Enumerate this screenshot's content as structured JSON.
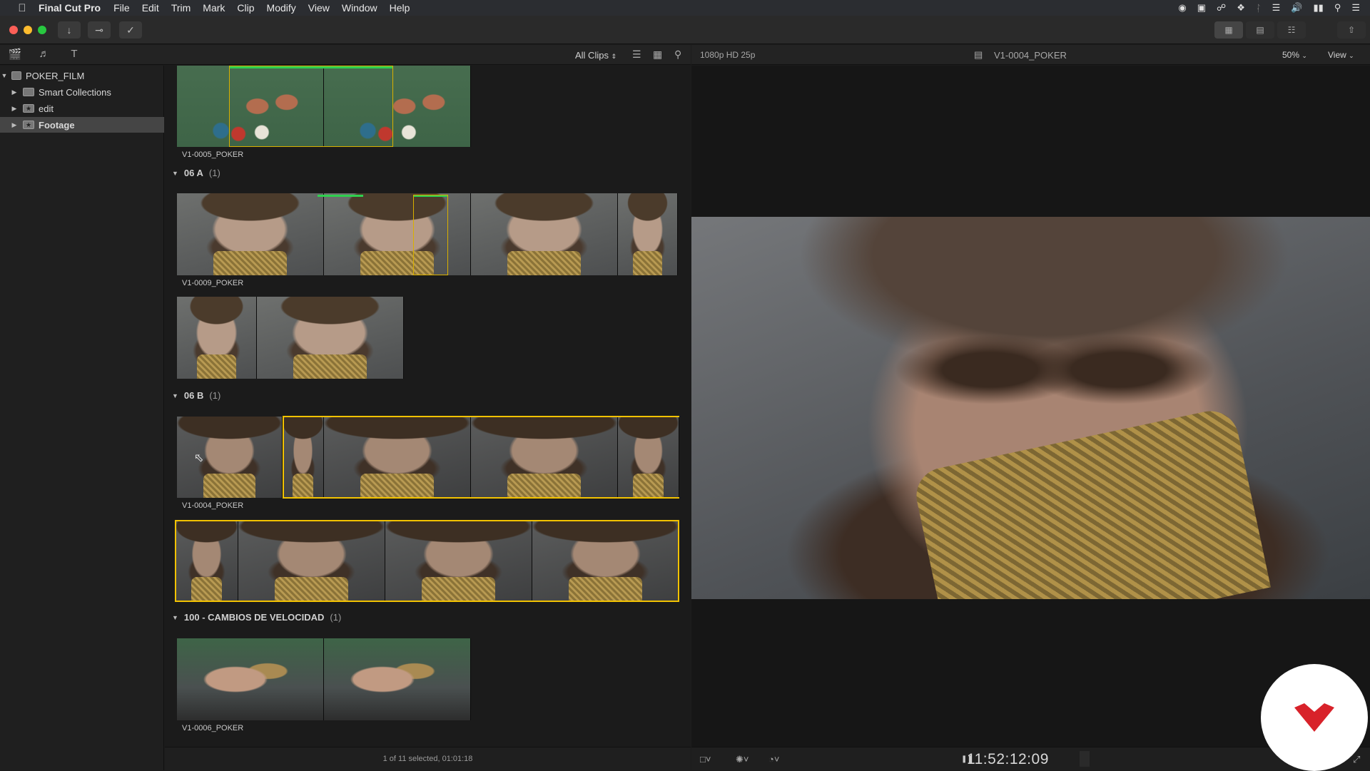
{
  "menubar": {
    "app_name": "Final Cut Pro",
    "items": [
      "File",
      "Edit",
      "Trim",
      "Mark",
      "Clip",
      "Modify",
      "View",
      "Window",
      "Help"
    ]
  },
  "sidebar": {
    "library": "POKER_FILM",
    "items": [
      {
        "label": "Smart Collections",
        "icon": "folder-icon"
      },
      {
        "label": "edit",
        "icon": "event-star-icon"
      },
      {
        "label": "Footage",
        "icon": "event-star-icon",
        "selected": true
      }
    ]
  },
  "browser": {
    "filter_label": "All Clips",
    "top_clip_label": "V1-0005_POKER",
    "sections": [
      {
        "title": "06 A",
        "count": "(1)",
        "clips": [
          "V1-0009_POKER"
        ]
      },
      {
        "title": "06 B",
        "count": "(1)",
        "clips": [
          "V1-0004_POKER"
        ]
      },
      {
        "title": "100 - CAMBIOS DE VELOCIDAD",
        "count": "(1)",
        "clips": [
          "V1-0006_POKER"
        ]
      }
    ],
    "footer_status": "1 of 11 selected, 01:01:18"
  },
  "viewer": {
    "format": "1080p HD 25p",
    "clip_name": "V1-0004_POKER",
    "zoom": "50%",
    "view_label": "View",
    "timecode": "11:52:12:09"
  },
  "colors": {
    "selection": "#f2c200",
    "favorite_marker": "#2fd04f",
    "logo_red": "#d8222a"
  }
}
